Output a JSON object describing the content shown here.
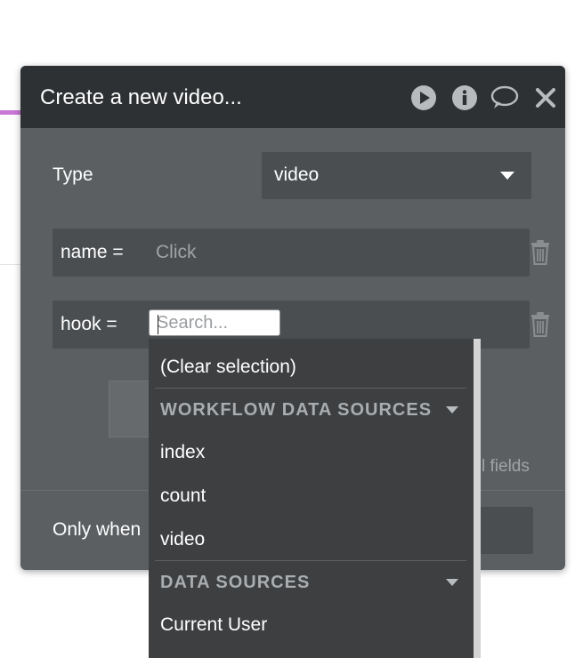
{
  "dialog": {
    "title": "Create a new video...",
    "icons": [
      "play-icon",
      "info-icon",
      "comment-icon",
      "close-icon"
    ]
  },
  "type_field": {
    "label": "Type",
    "value": "video"
  },
  "name_row": {
    "label": "name  =",
    "placeholder": "Click"
  },
  "hook_row": {
    "label": "hook  =",
    "search_placeholder": "Search..."
  },
  "fields_text": "l fields",
  "only_when": {
    "label": "Only when"
  },
  "dropdown": {
    "clear_label": "(Clear selection)",
    "sections": [
      {
        "title": "WORKFLOW DATA SOURCES",
        "items": [
          "index",
          "count",
          "video"
        ]
      },
      {
        "title": "DATA SOURCES",
        "items": [
          "Current User"
        ]
      }
    ]
  },
  "colors": {
    "header_bg": "#2e3133",
    "dialog_bg": "#5b5f62",
    "field_bg": "#4b4e51",
    "dropdown_bg": "#3d3f41",
    "accent": "#c978d6"
  }
}
